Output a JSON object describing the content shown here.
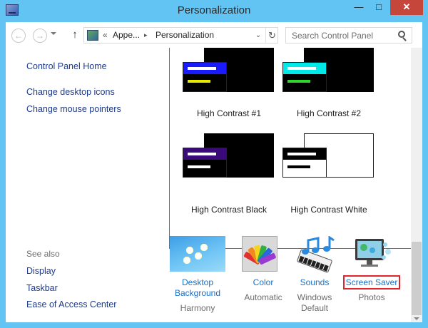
{
  "window": {
    "title": "Personalization"
  },
  "titlebar": {
    "min_glyph": "—",
    "max_glyph": "□",
    "close_glyph": "✕"
  },
  "nav": {
    "back_glyph": "←",
    "forward_glyph": "→",
    "up_glyph": "↑",
    "breadcrumb": {
      "overflow": "«",
      "item1": "Appe...",
      "separator": "▸",
      "item2": "Personalization"
    },
    "dropdown_glyph": "⌄",
    "refresh_glyph": "↻"
  },
  "search": {
    "placeholder": "Search Control Panel"
  },
  "sidebar": {
    "links": [
      "Control Panel Home",
      "Change desktop icons",
      "Change mouse pointers"
    ],
    "see_also_label": "See also",
    "see_also": [
      "Display",
      "Taskbar",
      "Ease of Access Center"
    ]
  },
  "themes": [
    {
      "label": "High Contrast #1",
      "bg": "#000000",
      "title_bar": "#1a1aff",
      "line2": "#e8e800",
      "front_bg": "#000000"
    },
    {
      "label": "High Contrast #2",
      "bg": "#000000",
      "title_bar": "#00e8e8",
      "line2": "#2fd42f",
      "front_bg": "#000000"
    },
    {
      "label": "High Contrast Black",
      "bg": "#000000",
      "title_bar": "#3a0a7a",
      "line2": "#ffffff",
      "front_bg": "#000000"
    },
    {
      "label": "High Contrast White",
      "bg": "#ffffff",
      "title_bar": "#000000",
      "line2": "#000000",
      "front_bg": "#ffffff"
    }
  ],
  "tiles": [
    {
      "label_lines": [
        "Desktop",
        "Background"
      ],
      "sub_lines": [
        "Harmony"
      ]
    },
    {
      "label_lines": [
        "Color"
      ],
      "sub_lines": [
        "Automatic"
      ]
    },
    {
      "label_lines": [
        "Sounds"
      ],
      "sub_lines": [
        "Windows",
        "Default"
      ]
    },
    {
      "label_lines": [
        "Screen Saver"
      ],
      "sub_lines": [
        "Photos"
      ]
    }
  ],
  "colors": {
    "link": "#1e3a8a",
    "tile_link": "#1c6fc3",
    "highlight_box": "#e0262c",
    "frame": "#61c4f3"
  }
}
